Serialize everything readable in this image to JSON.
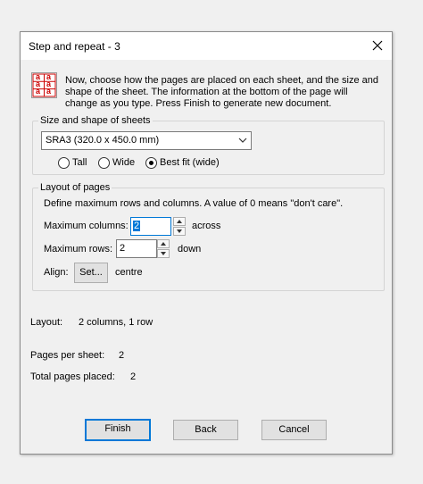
{
  "dialog": {
    "title": "Step and repeat - 3",
    "close_icon": "close-icon"
  },
  "intro": {
    "icon": "grid-a-icon",
    "icon_letter": "a",
    "text": "Now, choose how the pages are placed on each sheet, and the size and shape of the sheet. The information at the bottom of the page will change as you type. Press Finish to generate new document."
  },
  "size_group": {
    "title": "Size and shape of sheets",
    "sheet_select": "SRA3 (320.0 x 450.0 mm)",
    "orientation": [
      {
        "label": "Tall",
        "checked": false
      },
      {
        "label": "Wide",
        "checked": false
      },
      {
        "label": "Best fit (wide)",
        "checked": true
      }
    ]
  },
  "layout_group": {
    "title": "Layout of pages",
    "description": "Define maximum rows and columns. A value of 0 means \"don't care\".",
    "max_columns_label": "Maximum columns:",
    "max_columns_value": "2",
    "max_columns_unit": "across",
    "max_rows_label": "Maximum rows:",
    "max_rows_value": "2",
    "max_rows_unit": "down",
    "align_label": "Align:",
    "align_button": "Set...",
    "align_value": "centre"
  },
  "info": {
    "layout_label": "Layout:",
    "layout_value": "2 columns, 1 row",
    "pages_per_sheet_label": "Pages per sheet:",
    "pages_per_sheet_value": "2",
    "total_pages_label": "Total pages placed:",
    "total_pages_value": "2"
  },
  "buttons": {
    "finish": "Finish",
    "back": "Back",
    "cancel": "Cancel"
  },
  "colors": {
    "accent": "#0078d7",
    "icon_red": "#cc0000"
  }
}
